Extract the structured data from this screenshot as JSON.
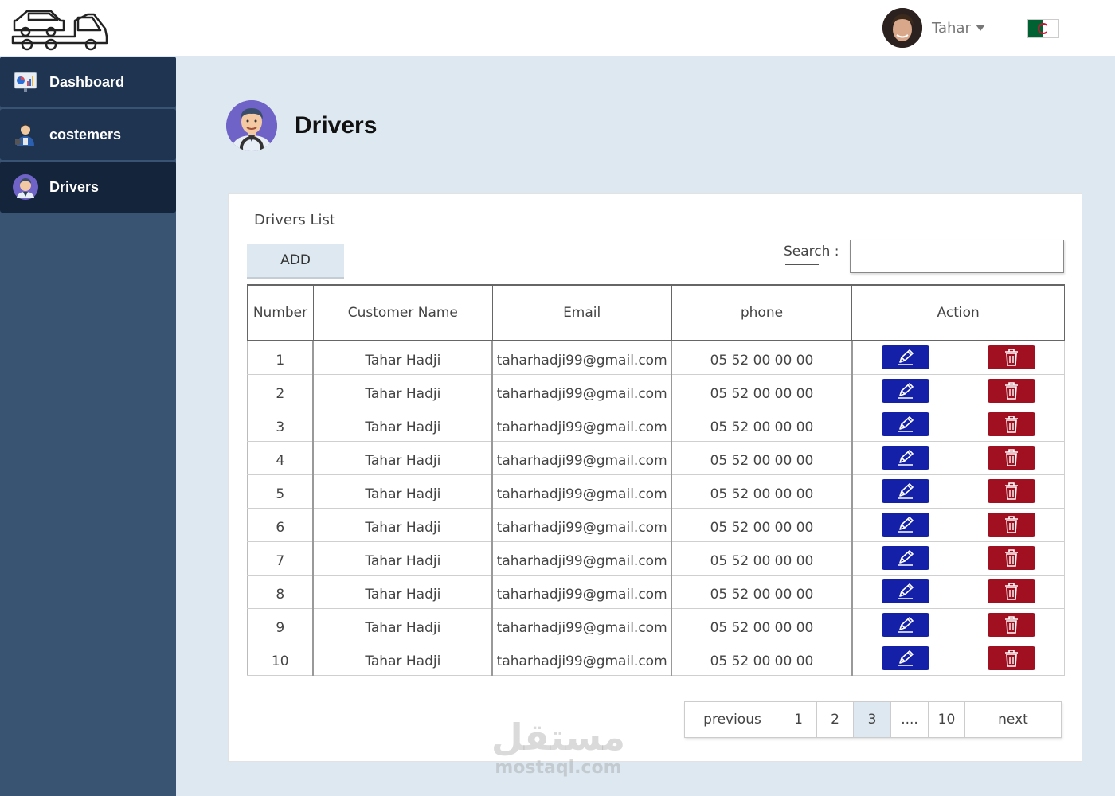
{
  "header": {
    "user_name": "Tahar"
  },
  "sidebar": {
    "items": [
      {
        "label": "Dashboard",
        "icon": "dashboard-icon"
      },
      {
        "label": "costemers",
        "icon": "customer-icon"
      },
      {
        "label": "Drivers",
        "icon": "driver-icon",
        "active": true
      }
    ]
  },
  "page": {
    "title": "Drivers"
  },
  "card": {
    "title": "Drivers List",
    "add_label": "ADD",
    "search_label": "Search :",
    "search_value": ""
  },
  "table": {
    "headers": [
      "Number",
      "Customer Name",
      "Email",
      "phone",
      "Action"
    ],
    "rows": [
      {
        "number": "1",
        "name": "Tahar Hadji",
        "email": "taharhadji99@gmail.com",
        "phone": "05 52 00 00 00"
      },
      {
        "number": "2",
        "name": "Tahar Hadji",
        "email": "taharhadji99@gmail.com",
        "phone": "05 52 00 00 00"
      },
      {
        "number": "3",
        "name": "Tahar Hadji",
        "email": "taharhadji99@gmail.com",
        "phone": "05 52 00 00 00"
      },
      {
        "number": "4",
        "name": "Tahar Hadji",
        "email": "taharhadji99@gmail.com",
        "phone": "05 52 00 00 00"
      },
      {
        "number": "5",
        "name": "Tahar Hadji",
        "email": "taharhadji99@gmail.com",
        "phone": "05 52 00 00 00"
      },
      {
        "number": "6",
        "name": "Tahar Hadji",
        "email": "taharhadji99@gmail.com",
        "phone": "05 52 00 00 00"
      },
      {
        "number": "7",
        "name": "Tahar Hadji",
        "email": "taharhadji99@gmail.com",
        "phone": "05 52 00 00 00"
      },
      {
        "number": "8",
        "name": "Tahar Hadji",
        "email": "taharhadji99@gmail.com",
        "phone": "05 52 00 00 00"
      },
      {
        "number": "9",
        "name": "Tahar Hadji",
        "email": "taharhadji99@gmail.com",
        "phone": "05 52 00 00 00"
      },
      {
        "number": "10",
        "name": "Tahar Hadji",
        "email": "taharhadji99@gmail.com",
        "phone": "05 52 00 00 00"
      }
    ]
  },
  "pagination": {
    "previous": "previous",
    "pages": [
      "1",
      "2",
      "3",
      "....",
      "10"
    ],
    "current": "3",
    "next": "next"
  },
  "watermark": {
    "arabic": "مستقل",
    "latin": "mostaql.com"
  },
  "colors": {
    "sidebar_bg": "#395373",
    "sidebar_item": "#1f3450",
    "content_bg": "#dde8f0",
    "edit_button": "#1420a8",
    "delete_button": "#a01020"
  }
}
